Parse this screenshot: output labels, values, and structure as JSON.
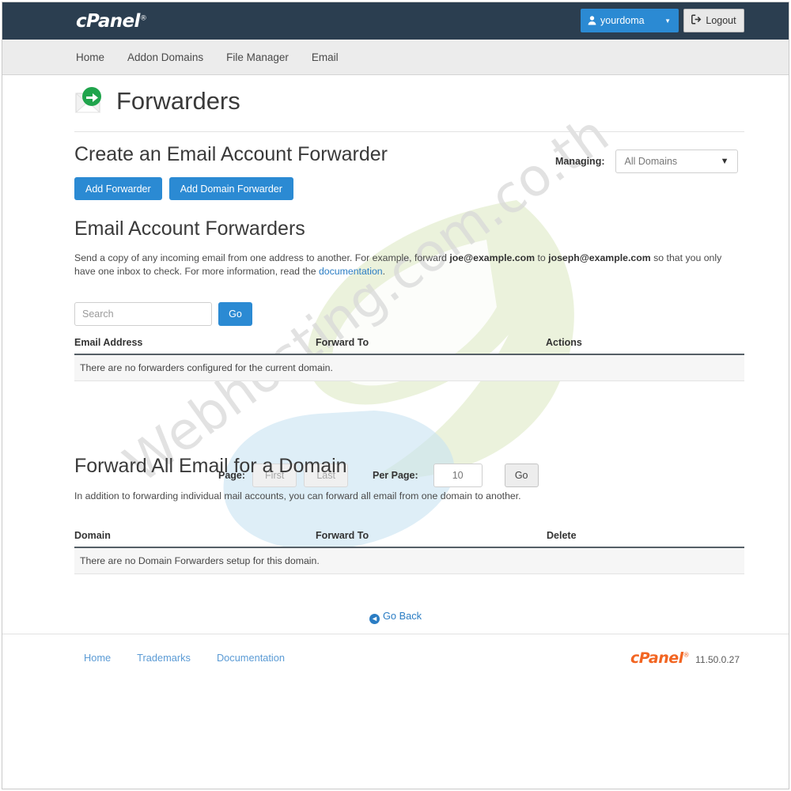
{
  "brand": {
    "name": "cPanel",
    "registered": "®"
  },
  "topbar": {
    "user_label": "yourdoma",
    "user_icon": "person-icon",
    "caret_icon": "chevron-down-icon",
    "logout_label": "Logout",
    "logout_icon": "logout-icon",
    "background": "#2b3e50",
    "accent": "#2b8ad3"
  },
  "nav": {
    "items": [
      {
        "label": "Home"
      },
      {
        "label": "Addon Domains"
      },
      {
        "label": "File Manager"
      },
      {
        "label": "Email"
      }
    ]
  },
  "page": {
    "title": "Forwarders",
    "icon": "forwarder-envelope-icon"
  },
  "create_section": {
    "heading": "Create an Email Account Forwarder",
    "managing_label": "Managing:",
    "managing_value": "All Domains",
    "managing_options": [
      "All Domains"
    ],
    "add_forwarder_label": "Add Forwarder",
    "add_domain_forwarder_label": "Add Domain Forwarder"
  },
  "email_forwarders": {
    "heading": "Email Account Forwarders",
    "desc_part1": "Send a copy of any incoming email from one address to another. For example, forward ",
    "desc_email_from": "joe@example.com",
    "desc_part2": " to ",
    "desc_email_to": "joseph@example.com",
    "desc_part3": " so that you only have one inbox to check. For more information, read the ",
    "desc_link": "documentation",
    "desc_part4": ".",
    "search_placeholder": "Search",
    "search_value": "",
    "go_label": "Go",
    "columns": [
      "Email Address",
      "Forward To",
      "Actions"
    ],
    "empty_message": "There are no forwarders configured for the current domain.",
    "rows": []
  },
  "pagination": {
    "page_label": "Page:",
    "first_label": "First",
    "last_label": "Last",
    "per_page_label": "Per Page:",
    "per_page_value": "10",
    "go_label": "Go"
  },
  "domain_forwarders": {
    "heading": "Forward All Email for a Domain",
    "description": "In addition to forwarding individual mail accounts, you can forward all email from one domain to another.",
    "columns": [
      "Domain",
      "Forward To",
      "Delete"
    ],
    "empty_message": "There are no Domain Forwarders setup for this domain.",
    "rows": []
  },
  "go_back": {
    "label": "Go Back",
    "icon": "arrow-left-circle-icon"
  },
  "footer": {
    "links": [
      {
        "label": "Home"
      },
      {
        "label": "Trademarks"
      },
      {
        "label": "Documentation"
      }
    ],
    "brand": "cPanel",
    "registered": "®",
    "version": "11.50.0.27",
    "brand_color": "#f26522"
  },
  "watermark": {
    "text": "Webhosting.com.co.th"
  }
}
